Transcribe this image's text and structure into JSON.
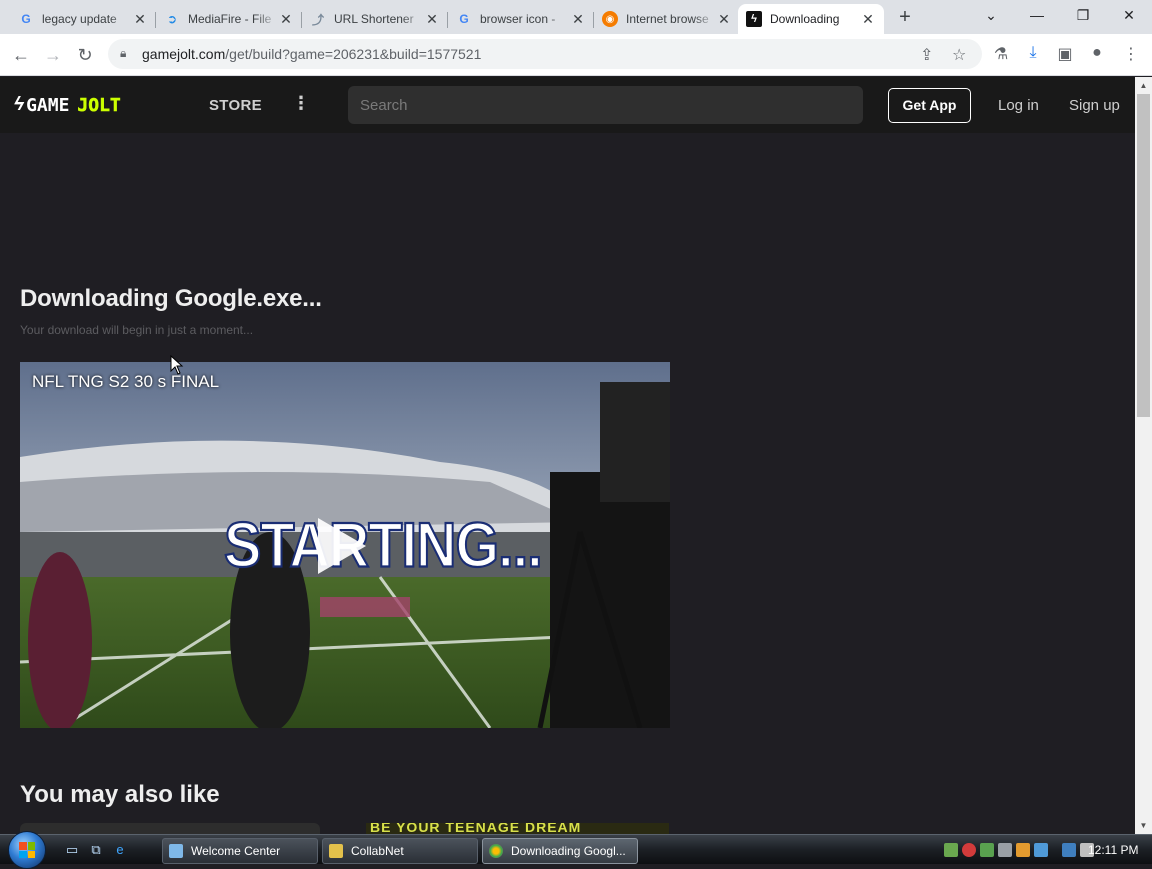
{
  "browser": {
    "tabs": [
      {
        "title": "legacy update",
        "favicon": "google-icon"
      },
      {
        "title": "MediaFire - File",
        "favicon": "mediafire-icon"
      },
      {
        "title": "URL Shortener",
        "favicon": "link-icon"
      },
      {
        "title": "browser icon -",
        "favicon": "google-icon"
      },
      {
        "title": "Internet browse",
        "favicon": "globe-icon"
      },
      {
        "title": "Downloading",
        "favicon": "gamejolt-icon"
      }
    ],
    "url_host": "gamejolt.com",
    "url_path": "/get/build?game=206231&build=1577521"
  },
  "site": {
    "logo_game": "GAME",
    "logo_jolt": "JOLT",
    "store_label": "STORE",
    "search_placeholder": "Search",
    "get_app_label": "Get App",
    "login_label": "Log in",
    "signup_label": "Sign up"
  },
  "download": {
    "title": "Downloading Google.exe...",
    "subtitle": "Your download will begin in just a moment..."
  },
  "video": {
    "title": "NFL TNG S2 30 s FINAL",
    "overlay_text": "STARTING..."
  },
  "recommendations": {
    "heading": "You may also like",
    "thumb2_text": "BE YOUR TEENAGE DREAM"
  },
  "taskbar": {
    "tasks": [
      {
        "label": "Welcome Center"
      },
      {
        "label": "CollabNet"
      },
      {
        "label": "Downloading Googl..."
      }
    ],
    "clock": "12:11 PM"
  },
  "colors": {
    "page_bg": "#1f1e23",
    "nav_bg": "#191919",
    "accent": "#ccff00"
  }
}
